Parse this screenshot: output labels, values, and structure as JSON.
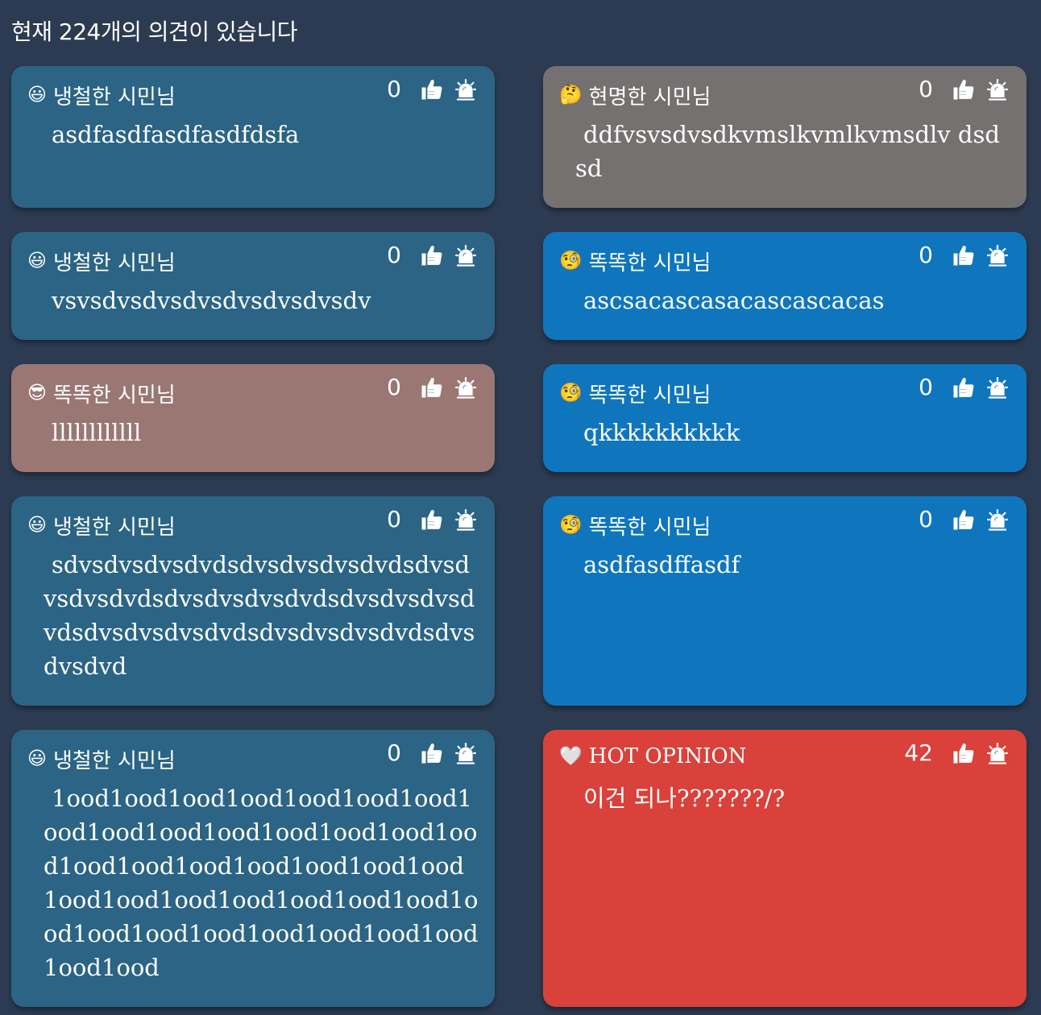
{
  "header": {
    "title": "현재 224개의 의견이 있습니다"
  },
  "icons": {
    "like": "thumbs-up-icon",
    "report": "siren-alert-icon"
  },
  "colors": {
    "background": "#2c3b52",
    "blue_dark": "#2b6484",
    "blue_bright": "#0f76bd",
    "gray": "#757170",
    "rose": "#9a7773",
    "red": "#d9413a"
  },
  "cards": [
    {
      "emoji": "😃",
      "author": "냉철한 시민님",
      "likes": "0",
      "text": "asdfasdfasdfasdfdsfa",
      "color": "#2b6484"
    },
    {
      "emoji": "🤔",
      "author": "현명한 시민님",
      "likes": "0",
      "text": "ddfvsvsdvsdkvmslkvmlkvmsdlv dsdsd",
      "color": "#757170"
    },
    {
      "emoji": "😃",
      "author": "냉철한 시민님",
      "likes": "0",
      "text": "vsvsdvsdvsdvsdvsdvsdvsdv",
      "color": "#2b6484"
    },
    {
      "emoji": "🧐",
      "author": "똑똑한 시민님",
      "likes": "0",
      "text": "ascsacascasacascascacas",
      "color": "#0f76bd"
    },
    {
      "emoji": "😎",
      "author": "똑똑한 시민님",
      "likes": "0",
      "text": "llllllllllll",
      "color": "#9a7773"
    },
    {
      "emoji": "🧐",
      "author": "똑똑한 시민님",
      "likes": "0",
      "text": "qkkkkkkkkkk",
      "color": "#0f76bd"
    },
    {
      "emoji": "😃",
      "author": "냉철한 시민님",
      "likes": "0",
      "text": "sdvsdvsdvsdvdsdvsdvsdvsdvdsdvsdvsdvsdvdsdvsdvsdvsdvdsdvsdvsdvsdvdsdvsdvsdvsdvdsdvsdvsdvsdvdsdvsdvsdvd",
      "color": "#2b6484"
    },
    {
      "emoji": "🧐",
      "author": "똑똑한 시민님",
      "likes": "0",
      "text": "asdfasdffasdf",
      "color": "#0f76bd"
    },
    {
      "emoji": "😃",
      "author": "냉철한 시민님",
      "likes": "0",
      "text": "1ood1ood1ood1ood1ood1ood1ood1ood1ood1ood1ood1ood1ood1ood1ood1ood1ood1ood1ood1ood1ood1ood1ood1ood1ood1ood1ood1ood1ood1ood1ood1ood1ood1ood1ood1ood1ood1ood1ood",
      "color": "#2b6484"
    },
    {
      "emoji": "🤍",
      "author": "HOT OPINION",
      "likes": "42",
      "text": "이건 되나???????/?",
      "color": "#d9413a",
      "hot": true
    }
  ]
}
